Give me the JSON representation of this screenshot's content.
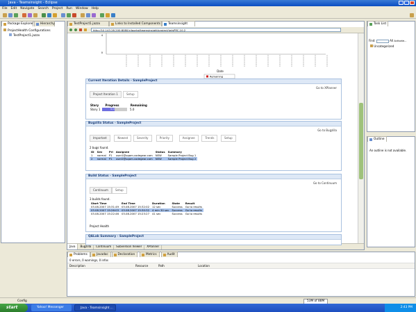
{
  "window": {
    "title": "Java - Teamsinsight - Eclipse"
  },
  "menu": [
    "File",
    "Edit",
    "Navigate",
    "Search",
    "Project",
    "Run",
    "Window",
    "Help"
  ],
  "package_explorer": {
    "tabs": [
      "Package Explorer",
      "Hierarchy"
    ],
    "tree": [
      "ProjectHealth Configurations",
      "TestProject1.jazzx"
    ]
  },
  "editor_tabs": [
    "TestProject1.jazzx",
    "Links to Installed Components",
    "Teamsinsight"
  ],
  "browser": {
    "url": "http://10.143.28.200:8080/cilportal/teamsinsight/project/jw/sPRC.10.2"
  },
  "chart": {
    "xlabel": "Date",
    "legend": "Remaining",
    "axis_ticks": [
      "4",
      "0"
    ]
  },
  "iteration": {
    "title": "Current Iteration Details - SampleProject",
    "goto": "Go to XPlanner",
    "tabs": [
      "Project Iteration 1",
      "Setup"
    ],
    "headers": [
      "Story",
      "Progress",
      "Remaining"
    ],
    "row": {
      "story": "Story 1",
      "progress_label": "5.0",
      "remaining": "5.0",
      "progress_fraction": 0.5
    }
  },
  "bugzilla": {
    "title": "Bugzilla Status - SampleProject",
    "goto": "Go to Bugzilla",
    "tabs": [
      "Important",
      "Newest",
      "Severity",
      "Priority",
      "Assignee",
      "Trends",
      "Setup"
    ],
    "found": "2 bugs found.",
    "headers": [
      "ID",
      "Sev",
      "Pri",
      "Assignee",
      "Status",
      "Summary"
    ],
    "rows": [
      [
        "1",
        "normal",
        "P1",
        "user1@sqam.codegear.com",
        "NEW",
        "Sample Project Bug 1"
      ],
      [
        "2",
        "normal",
        "P1",
        "user2@sqam.codegear.com",
        "NEW",
        "Sample Project Bug 2"
      ]
    ]
  },
  "build": {
    "title": "Build Status - SampleProject",
    "goto": "Go to Continuum",
    "tabs": [
      "Continuum",
      "Setup"
    ],
    "found": "3 builds found.",
    "headers": [
      "Start Time",
      "End Time",
      "Duration",
      "State",
      "Result"
    ],
    "rows": [
      [
        "03.08.2007 15:31:49",
        "03.08.2007 15:32:02",
        "12 sec",
        "Success",
        "Go to results"
      ],
      [
        "03.08.2007 15:26:03",
        "03.08.2007 15:30:32",
        "4 min 30 sec",
        "Success",
        "Go to results"
      ],
      [
        "03.08.2007 15:22:46",
        "03.08.2007 15:23:27",
        "41 sec",
        "Success",
        "Go to results"
      ]
    ],
    "health": "Project Health"
  },
  "qalab": {
    "title": "QALab Summary - SampleProject"
  },
  "editor_bottom_tabs": [
    "Java",
    "Bugzilla",
    "Continuum",
    "Subversion Viewer",
    "XPlanner"
  ],
  "problems": {
    "tabs": [
      "Problems",
      "Javadoc",
      "Declaration",
      "Metrics",
      "Audit"
    ],
    "summary": "0 errors, 0 warnings, 0 infos",
    "columns": [
      "Description",
      "Resource",
      "Path",
      "Location"
    ]
  },
  "task_list": {
    "tab": "Task List",
    "find_label": "Find:",
    "all_label": "All",
    "activate_label": "Activate...",
    "category": "Uncategorized"
  },
  "outline": {
    "tab": "Outline",
    "message": "An outline is not available."
  },
  "status_bar": {
    "left": "Config",
    "memory": "53M of 88M"
  },
  "taskbar": {
    "start": "start",
    "buttons": [
      "Yahoo! Messenger",
      "Java - Teamsinsight ..."
    ],
    "clock": "2:43 PM"
  }
}
